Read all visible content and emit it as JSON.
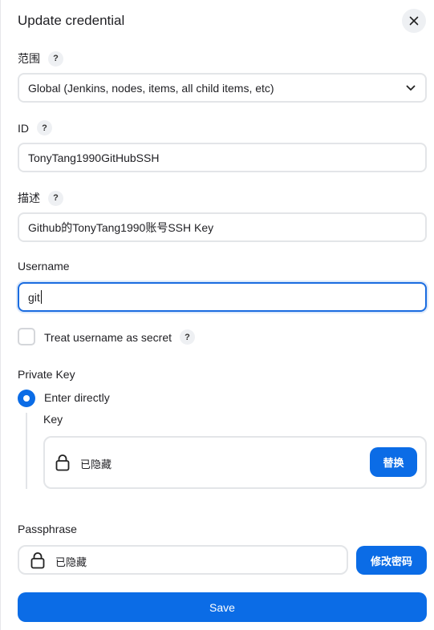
{
  "dialog": {
    "title": "Update credential",
    "close_icon": "close-icon"
  },
  "scope": {
    "label": "范围",
    "help": "?",
    "value": "Global (Jenkins, nodes, items, all child items, etc)"
  },
  "id": {
    "label": "ID",
    "help": "?",
    "value": "TonyTang1990GitHubSSH"
  },
  "description": {
    "label": "描述",
    "help": "?",
    "value": "Github的TonyTang1990账号SSH Key"
  },
  "username": {
    "label": "Username",
    "value": "git"
  },
  "treat_username_secret": {
    "label": "Treat username as secret",
    "help": "?",
    "checked": false
  },
  "private_key": {
    "label": "Private Key",
    "option_label": "Enter directly",
    "selected": true,
    "key_label": "Key",
    "hidden_text": "已隐藏",
    "replace_button": "替换"
  },
  "passphrase": {
    "label": "Passphrase",
    "hidden_text": "已隐藏",
    "change_button": "修改密码"
  },
  "save_button": "Save",
  "colors": {
    "primary": "#0b6ce6",
    "border": "#e3e5e8",
    "focus": "#1a6ce0"
  }
}
